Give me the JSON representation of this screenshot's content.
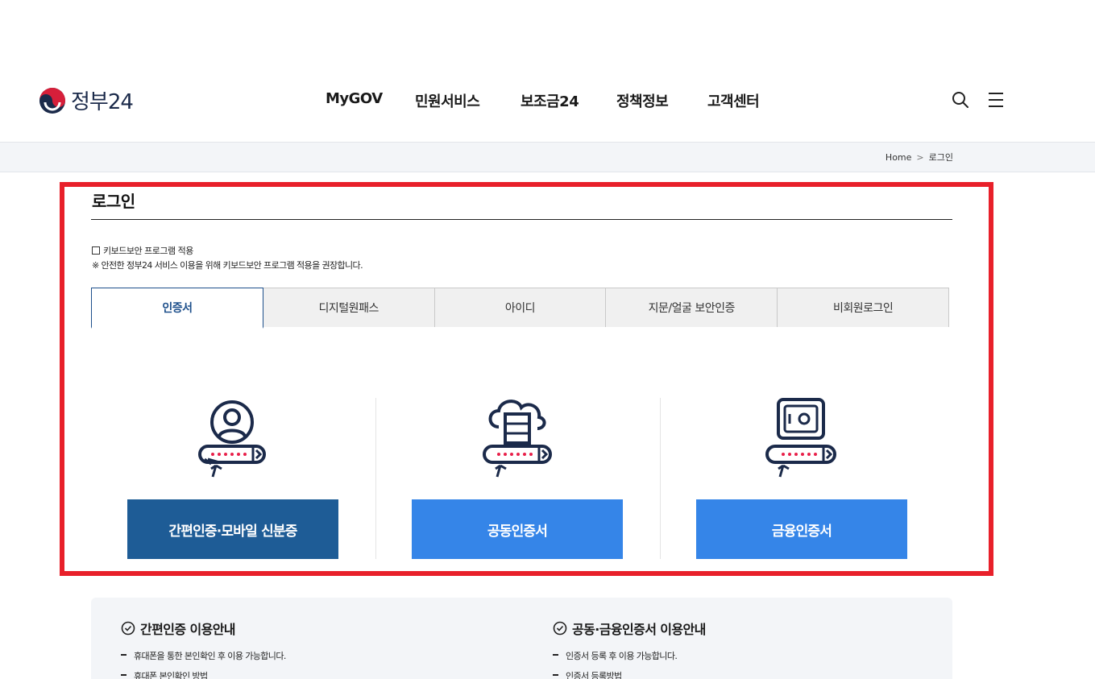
{
  "header": {
    "logo_text": "정부24",
    "nav": [
      "MyGOV",
      "민원서비스",
      "보조금24",
      "정책정보",
      "고객센터"
    ]
  },
  "breadcrumb": {
    "home": "Home",
    "sep": ">",
    "current": "로그인"
  },
  "login": {
    "title": "로그인",
    "keyboard_label": "키보드보안 프로그램 적용",
    "keyboard_note": "※ 안전한 정부24 서비스 이용을 위해 키보드보안 프로그램 적용을 권장합니다.",
    "tabs": [
      "인증서",
      "디지털원패스",
      "아이디",
      "지문/얼굴 보안인증",
      "비회원로그인"
    ],
    "active_tab": "인증서",
    "buttons": {
      "simple": "간편인증·모바일 신분증",
      "joint": "공동인증서",
      "financial": "금융인증서"
    }
  },
  "info": {
    "left_title": "간편인증 이용안내",
    "left_items": [
      "휴대폰을 통한 본인확인 후 이용 가능합니다.",
      "휴대폰 본인확인 방법"
    ],
    "right_title": "공동·금융인증서 이용안내",
    "right_items": [
      "인증서 등록 후 이용 가능합니다.",
      "인증서 등록방법"
    ]
  },
  "colors": {
    "brand_navy": "#1b2a4a",
    "tab_active": "#1d4f8b",
    "btn_dark": "#1e5c96",
    "btn_light": "#3585e8",
    "highlight": "#e8202a",
    "icon_accent": "#e8204a"
  },
  "icons": [
    "taegeuk-logo-icon",
    "search-icon",
    "menu-icon",
    "user-badge-icon",
    "cloud-server-icon",
    "safe-icon",
    "check-circle-icon"
  ]
}
